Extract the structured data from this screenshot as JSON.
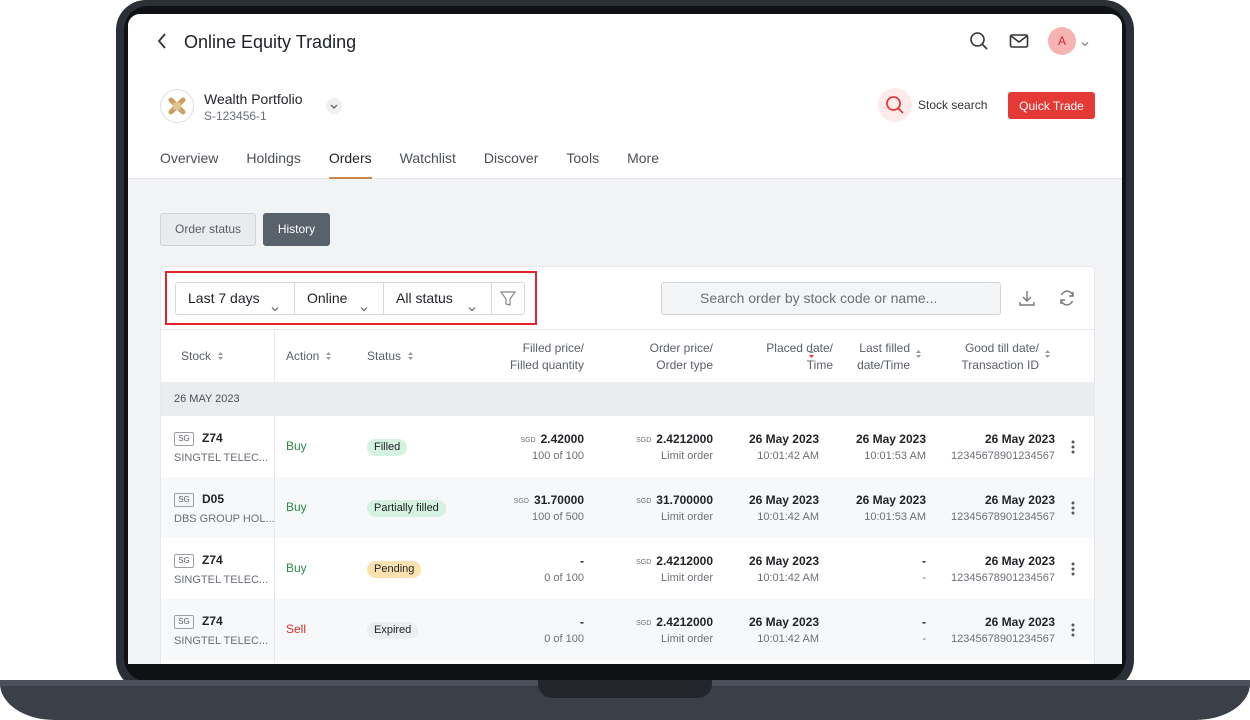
{
  "app": {
    "title": "Online Equity Trading",
    "avatar_initial": "A"
  },
  "portfolio": {
    "name": "Wealth Portfolio",
    "id": "S-123456-1"
  },
  "actions": {
    "stock_search": "Stock search",
    "quick_trade": "Quick Trade"
  },
  "tabs": [
    {
      "label": "Overview"
    },
    {
      "label": "Holdings"
    },
    {
      "label": "Orders",
      "active": true
    },
    {
      "label": "Watchlist"
    },
    {
      "label": "Discover"
    },
    {
      "label": "Tools"
    },
    {
      "label": "More"
    }
  ],
  "segments": {
    "order_status": "Order status",
    "history": "History",
    "selected": "History"
  },
  "filters": {
    "period": "Last 7 days",
    "channel": "Online",
    "status": "All status"
  },
  "search": {
    "placeholder": "Search order by stock code or name..."
  },
  "columns": {
    "stock": "Stock",
    "action": "Action",
    "status": "Status",
    "filled_1": "Filled price/",
    "filled_2": "Filled quantity",
    "order_1": "Order price/",
    "order_2": "Order type",
    "placed_1": "Placed date/",
    "placed_2": "Time",
    "last_1": "Last filled",
    "last_2": "date/Time",
    "good_1": "Good till date/",
    "good_2": "Transaction ID"
  },
  "group": {
    "label": "26 MAY 2023"
  },
  "rows": [
    {
      "market": "SG",
      "code": "Z74",
      "name": "SINGTEL TELEC...",
      "action": "Buy",
      "status": "Filled",
      "filled_ccy": "SGD",
      "filled_price": "2.42000",
      "filled_qty": "100 of 100",
      "order_ccy": "SGD",
      "order_price": "2.4212000",
      "order_type": "Limit order",
      "placed_date": "26 May 2023",
      "placed_time": "10:01:42 AM",
      "last_date": "26 May 2023",
      "last_time": "10:01:53 AM",
      "good_date": "26 May 2023",
      "txn_id": "12345678901234567"
    },
    {
      "market": "SG",
      "code": "D05",
      "name": "DBS GROUP HOL...",
      "action": "Buy",
      "status": "Partially filled",
      "filled_ccy": "SGD",
      "filled_price": "31.70000",
      "filled_qty": "100 of 500",
      "order_ccy": "SGD",
      "order_price": "31.700000",
      "order_type": "Limit order",
      "placed_date": "26 May 2023",
      "placed_time": "10:01:42 AM",
      "last_date": "26 May 2023",
      "last_time": "10:01:53 AM",
      "good_date": "26 May 2023",
      "txn_id": "12345678901234567"
    },
    {
      "market": "SG",
      "code": "Z74",
      "name": "SINGTEL TELEC...",
      "action": "Buy",
      "status": "Pending",
      "filled_ccy": "",
      "filled_price": "-",
      "filled_qty": "0 of 100",
      "order_ccy": "SGD",
      "order_price": "2.4212000",
      "order_type": "Limit order",
      "placed_date": "26 May 2023",
      "placed_time": "10:01:42 AM",
      "last_date": "-",
      "last_time": "-",
      "good_date": "26 May 2023",
      "txn_id": "12345678901234567"
    },
    {
      "market": "SG",
      "code": "Z74",
      "name": "SINGTEL TELEC...",
      "action": "Sell",
      "status": "Expired",
      "filled_ccy": "",
      "filled_price": "-",
      "filled_qty": "0 of 100",
      "order_ccy": "SGD",
      "order_price": "2.4212000",
      "order_type": "Limit order",
      "placed_date": "26 May 2023",
      "placed_time": "10:01:42 AM",
      "last_date": "-",
      "last_time": "-",
      "good_date": "26 May 2023",
      "txn_id": "12345678901234567"
    }
  ],
  "colors": {
    "accent": "#e53935",
    "tab_underline": "#c8864a",
    "buy": "#2e8a46",
    "sell": "#d93025",
    "highlight_box": "#e0262c"
  }
}
